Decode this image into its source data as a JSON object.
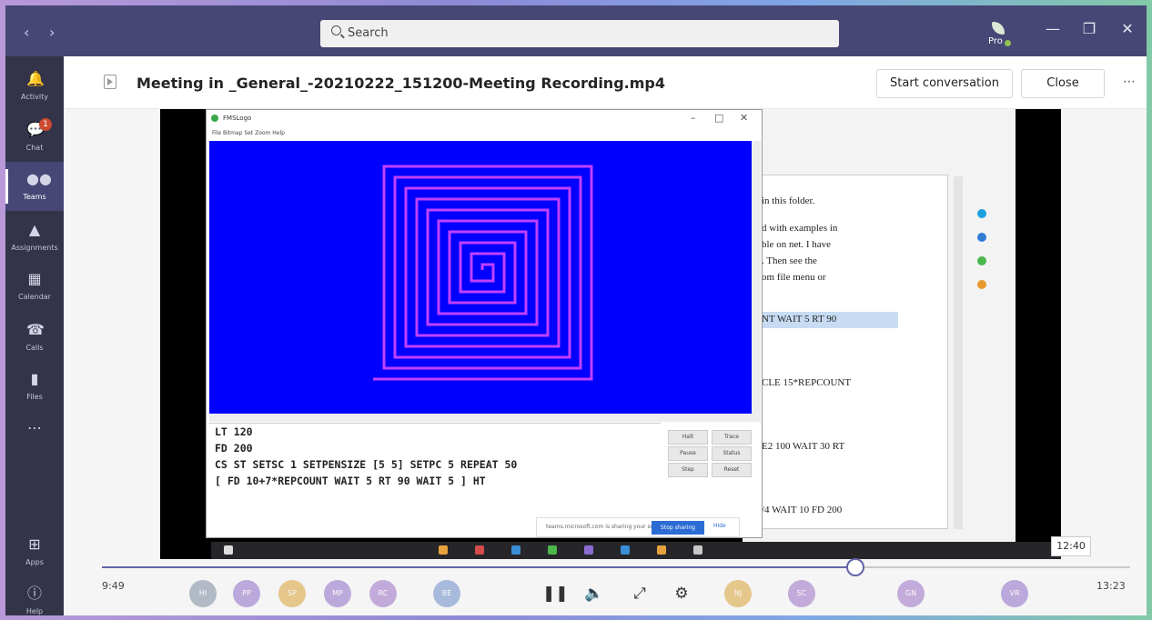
{
  "titlebar": {
    "search_placeholder": "Search",
    "profile_label": "Pro"
  },
  "rail": [
    {
      "label": "Activity",
      "icon": "bell-icon"
    },
    {
      "label": "Chat",
      "icon": "chat-icon",
      "badge": "1"
    },
    {
      "label": "Teams",
      "icon": "teams-icon",
      "active": true
    },
    {
      "label": "Assignments",
      "icon": "assignments-icon"
    },
    {
      "label": "Calendar",
      "icon": "calendar-icon"
    },
    {
      "label": "Calls",
      "icon": "phone-icon"
    },
    {
      "label": "Files",
      "icon": "file-icon"
    }
  ],
  "rail_bottom": [
    {
      "label": "Apps",
      "icon": "apps-icon"
    },
    {
      "label": "Help",
      "icon": "help-icon"
    }
  ],
  "header": {
    "title": "Meeting in _General_-20210222_151200-Meeting Recording.mp4",
    "start_conversation": "Start conversation",
    "close": "Close"
  },
  "player": {
    "elapsed": "9:49",
    "total": "13:23",
    "hover_time": "12:40",
    "progress": 0.733
  },
  "screen_share": {
    "app_title": "FMSLogo",
    "menu": "File  Bitmap  Set  Zoom  Help",
    "code": [
      "LT 120",
      "FD 200",
      "CS ST SETSC 1 SETPENSIZE [5 5] SETPC 5 REPEAT 50",
      "[ FD 10+7*REPCOUNT WAIT 5 RT 90 WAIT 5 ] HT"
    ],
    "doc_lines": [
      "in this folder.",
      "d with examples in",
      "ble on net. I have",
      ". Then see the",
      "om file menu or",
      "NT WAIT 5 RT 90",
      "CLE 15*REPCOUNT",
      "E2 100 WAIT 30 RT",
      "/4 WAIT 10 FD 200"
    ],
    "logo_buttons": [
      "Halt",
      "Trace",
      "Pause",
      "Status",
      "Step",
      "Reset"
    ],
    "share_text": "teams.microsoft.com is sharing your screen.",
    "stop_sharing": "Stop sharing",
    "hide": "Hide"
  },
  "participants": [
    "HI",
    "PP",
    "SP",
    "MP",
    "RC",
    "BE",
    "NJ",
    "SC",
    "GN",
    "VR"
  ],
  "colors": {
    "titlebar": "#464775",
    "rail": "#33344a",
    "accent": "#6264a7",
    "canvas": "#0000ff",
    "spiral": "#c040ff"
  }
}
